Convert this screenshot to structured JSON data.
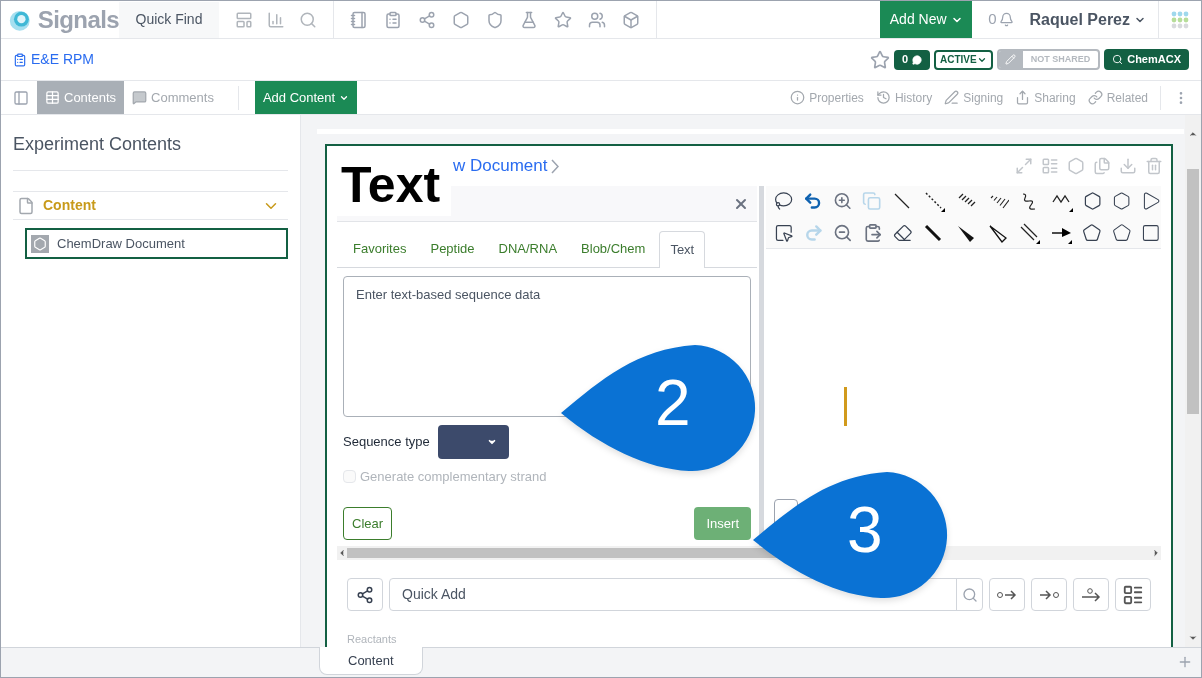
{
  "nav": {
    "brand": "Signals",
    "quick_find": "Quick Find",
    "add_new": "Add New",
    "notifications": "0",
    "user": "Raquel Perez"
  },
  "header": {
    "title": "E&E RPM",
    "comments_count": "0",
    "status": "ACTIVE",
    "sharing": "NOT SHARED",
    "chemacx": "ChemACX"
  },
  "toolbar": {
    "tabs": [
      {
        "label": "Contents",
        "selected": true
      },
      {
        "label": "Comments",
        "selected": false
      }
    ],
    "add_content": "Add Content",
    "actions": [
      "Properties",
      "History",
      "Signing",
      "Sharing",
      "Related"
    ]
  },
  "sidebar": {
    "title": "Experiment Contents",
    "section": {
      "label": "Content",
      "expanded": true
    },
    "items": [
      {
        "label": "ChemDraw Document",
        "selected": true
      }
    ]
  },
  "document": {
    "title": "w Document"
  },
  "overlay_title": "Text",
  "sequence_panel": {
    "tabs": [
      {
        "label": "Favorites",
        "selected": false
      },
      {
        "label": "Peptide",
        "selected": false
      },
      {
        "label": "DNA/RNA",
        "selected": false
      },
      {
        "label": "Blob/Chem",
        "selected": false
      },
      {
        "label": "Text",
        "selected": true
      }
    ],
    "placeholder": "Enter text-based sequence data",
    "sequence_type_label": "Sequence type",
    "complementary": {
      "label": "Generate complementary strand",
      "checked": false,
      "disabled": true
    },
    "clear": "Clear",
    "insert": "Insert"
  },
  "quick_add": {
    "placeholder": "Quick Add"
  },
  "reactants_label": "Reactants",
  "callouts": [
    {
      "label": "2"
    },
    {
      "label": "3"
    }
  ],
  "bottom_tabs": [
    {
      "label": "Content",
      "selected": true
    }
  ]
}
